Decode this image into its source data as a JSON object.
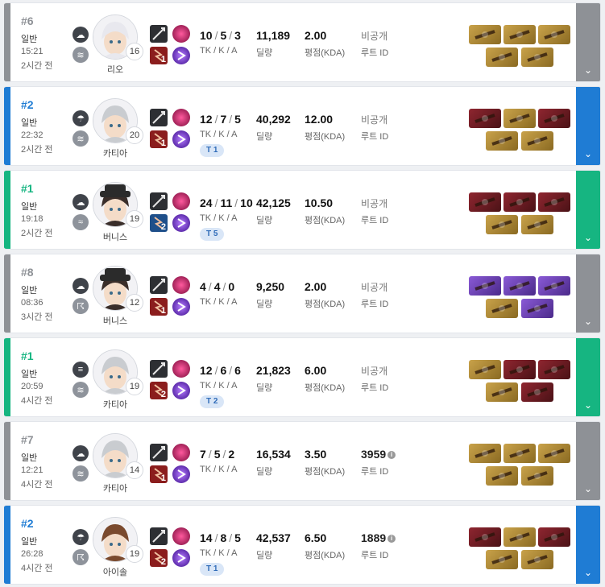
{
  "labels": {
    "tka": "TK / K / A",
    "damage": "딜량",
    "score": "평점(KDA)",
    "route": "루트 ID",
    "chevron": "⌄"
  },
  "colors": {
    "gray": "#8e9196",
    "blue": "#1f7cd4",
    "green": "#16b581"
  },
  "matches": [
    {
      "rank": "#6",
      "mode": "일반",
      "time": "15:21",
      "ago": "2시간 전",
      "weather1_icon": "cloud-icon",
      "weather2_icon": "fog-icon",
      "char": "리오",
      "char_icon": "rio-portrait",
      "level": "16",
      "weapon_icon": "bow-icon",
      "trait_num": "1",
      "tk": "10",
      "k": "5",
      "a": "3",
      "team": "",
      "damage": "11,189",
      "score": "2.00",
      "route": "비공개",
      "accent": "gray",
      "items": [
        "gold",
        "gold",
        "gold",
        "gold",
        "gold"
      ]
    },
    {
      "rank": "#2",
      "mode": "일반",
      "time": "22:32",
      "ago": "2시간 전",
      "weather1_icon": "rain-icon",
      "weather2_icon": "fog-icon",
      "char": "카티아",
      "char_icon": "katja-portrait",
      "level": "20",
      "weapon_icon": "sniper-icon",
      "trait_num": "1",
      "tk": "12",
      "k": "7",
      "a": "5",
      "team": "T 1",
      "damage": "40,292",
      "score": "12.00",
      "route": "비공개",
      "accent": "blue",
      "items": [
        "red",
        "gold",
        "red",
        "gold",
        "gold"
      ]
    },
    {
      "rank": "#1",
      "mode": "일반",
      "time": "19:18",
      "ago": "2시간 전",
      "weather1_icon": "cloud-icon",
      "weather2_icon": "wind-icon",
      "char": "버니스",
      "char_icon": "bernice-portrait",
      "level": "19",
      "weapon_icon": "shotgun-icon",
      "trait_num": "2",
      "tk": "24",
      "k": "11",
      "a": "10",
      "team": "T 5",
      "damage": "42,125",
      "score": "10.50",
      "route": "비공개",
      "accent": "green",
      "items": [
        "red",
        "red",
        "red",
        "gold",
        "gold"
      ]
    },
    {
      "rank": "#8",
      "mode": "일반",
      "time": "08:36",
      "ago": "3시간 전",
      "weather1_icon": "cloud-icon",
      "weather2_icon": "storm-icon",
      "char": "버니스",
      "char_icon": "bernice-portrait",
      "level": "12",
      "weapon_icon": "shotgun-icon",
      "trait_num": "1",
      "tk": "4",
      "k": "4",
      "a": "0",
      "team": "",
      "damage": "9,250",
      "score": "2.00",
      "route": "비공개",
      "accent": "gray",
      "items": [
        "purple",
        "purple",
        "purple",
        "gold",
        "purple"
      ]
    },
    {
      "rank": "#1",
      "mode": "일반",
      "time": "20:59",
      "ago": "4시간 전",
      "weather1_icon": "tornado-icon",
      "weather2_icon": "fog-icon",
      "char": "카티아",
      "char_icon": "katja-portrait",
      "level": "19",
      "weapon_icon": "sniper-icon",
      "trait_num": "2",
      "tk": "12",
      "k": "6",
      "a": "6",
      "team": "T 2",
      "damage": "21,823",
      "score": "6.00",
      "route": "비공개",
      "accent": "green",
      "items": [
        "gold",
        "red",
        "red",
        "gold",
        "red"
      ]
    },
    {
      "rank": "#7",
      "mode": "일반",
      "time": "12:21",
      "ago": "4시간 전",
      "weather1_icon": "cloud-icon",
      "weather2_icon": "fog-icon",
      "char": "카티아",
      "char_icon": "katja-portrait",
      "level": "14",
      "weapon_icon": "sniper-icon",
      "trait_num": "1",
      "tk": "7",
      "k": "5",
      "a": "2",
      "team": "",
      "damage": "16,534",
      "score": "3.50",
      "route": "3959",
      "accent": "gray",
      "items": [
        "gold",
        "gold",
        "gold",
        "gold",
        "gold"
      ]
    },
    {
      "rank": "#2",
      "mode": "일반",
      "time": "26:28",
      "ago": "4시간 전",
      "weather1_icon": "rain-icon",
      "weather2_icon": "storm-icon",
      "char": "아이솔",
      "char_icon": "isol-portrait",
      "level": "19",
      "weapon_icon": "rifle-icon",
      "trait_num": "2",
      "tk": "14",
      "k": "8",
      "a": "5",
      "team": "T 1",
      "damage": "42,537",
      "score": "6.50",
      "route": "1889",
      "accent": "blue",
      "items": [
        "red",
        "gold",
        "red",
        "gold",
        "gold"
      ]
    }
  ]
}
